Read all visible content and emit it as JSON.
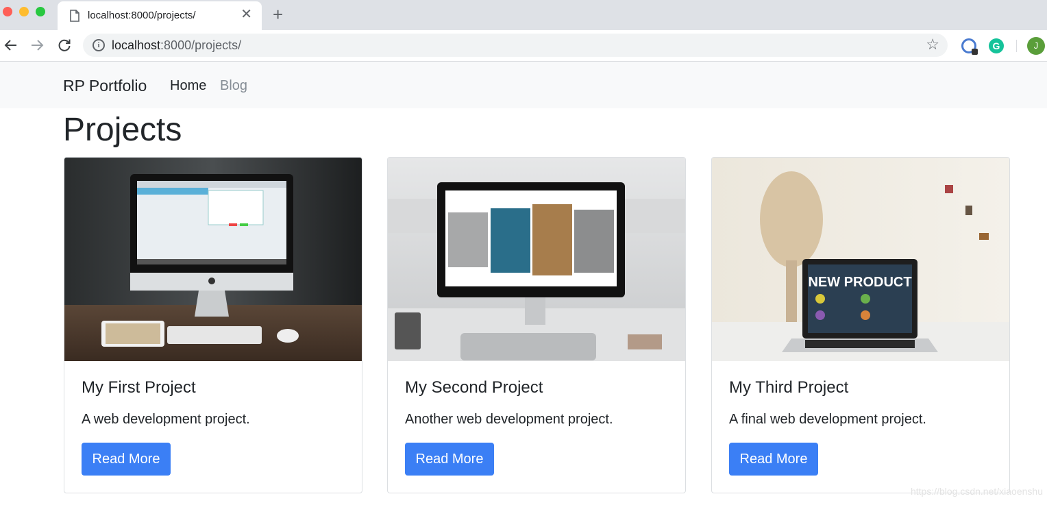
{
  "browser": {
    "tab_title": "localhost:8000/projects/",
    "url_host": "localhost",
    "url_rest": ":8000/projects/",
    "profile_initial": "J",
    "ext_grammarly_letter": "G",
    "close_glyph": "✕",
    "new_tab_glyph": "+",
    "star_glyph": "☆",
    "info_glyph": "i"
  },
  "navbar": {
    "brand": "RP Portfolio",
    "links": [
      {
        "label": "Home",
        "active": true
      },
      {
        "label": "Blog",
        "active": false
      }
    ]
  },
  "page": {
    "title": "Projects"
  },
  "projects": [
    {
      "title": "My First Project",
      "description": "A web development project.",
      "button": "Read More",
      "image": "desktop-computer-photo"
    },
    {
      "title": "My Second Project",
      "description": "Another web development project.",
      "button": "Read More",
      "image": "monitor-gallery-photo"
    },
    {
      "title": "My Third Project",
      "description": "A final web development project.",
      "button": "Read More",
      "image": "laptop-new-product-photo",
      "image_text": "NEW PRODUCT"
    }
  ],
  "watermark": "https://blog.csdn.net/xiaoenshu",
  "colors": {
    "primary": "#3b7ff5",
    "navbar_bg": "#f8f9fa",
    "muted_link": "#868e96"
  }
}
